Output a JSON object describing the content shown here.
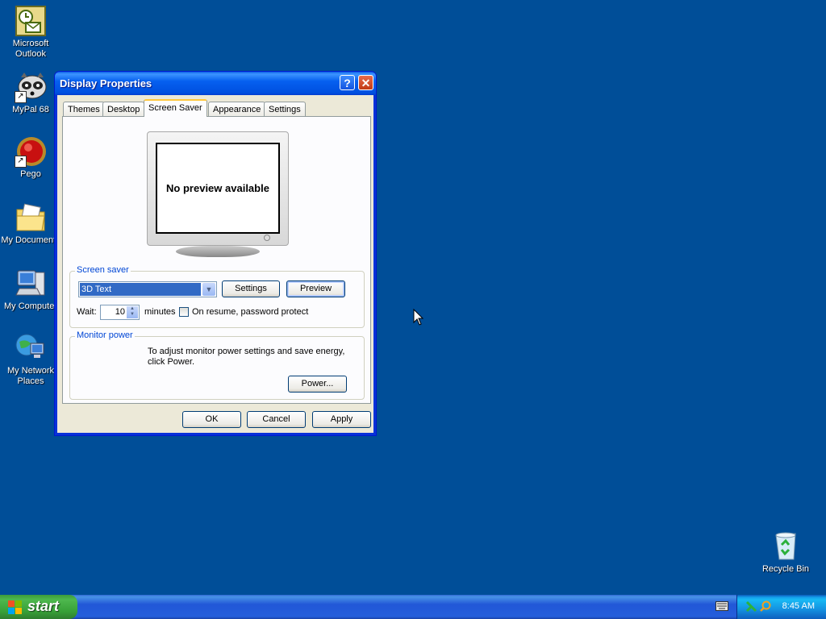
{
  "desktop": {
    "icons": [
      {
        "label": "Microsoft Outlook",
        "icon": "outlook-icon"
      },
      {
        "label": "MyPal 68",
        "icon": "raccoon-icon"
      },
      {
        "label": "Pego",
        "icon": "red-ball-icon"
      },
      {
        "label": "My Documents",
        "icon": "folder-icon"
      },
      {
        "label": "My Computer",
        "icon": "computer-icon"
      },
      {
        "label": "My Network Places",
        "icon": "network-icon"
      },
      {
        "label": "Recycle Bin",
        "icon": "recycle-bin-icon"
      }
    ]
  },
  "window": {
    "title": "Display Properties",
    "help_button": "?",
    "close_button": "✕",
    "tabs": [
      {
        "label": "Themes",
        "active": false
      },
      {
        "label": "Desktop",
        "active": false
      },
      {
        "label": "Screen Saver",
        "active": true
      },
      {
        "label": "Appearance",
        "active": false
      },
      {
        "label": "Settings",
        "active": false
      }
    ],
    "preview_text": "No preview available",
    "screen_saver_group": {
      "label": "Screen saver",
      "selected": "3D Text",
      "settings_button": "Settings",
      "preview_button": "Preview",
      "wait_label": "Wait:",
      "wait_value": "10",
      "minutes_label": "minutes",
      "password_label": "On resume, password protect",
      "password_checked": false
    },
    "monitor_power_group": {
      "label": "Monitor power",
      "description_line1": "To adjust monitor power settings and save energy,",
      "description_line2": "click Power.",
      "power_button": "Power..."
    },
    "buttons": {
      "ok": "OK",
      "cancel": "Cancel",
      "apply": "Apply"
    }
  },
  "taskbar": {
    "start_label": "start",
    "clock": "8:45 AM"
  },
  "colors": {
    "desktop": "#004e98",
    "titlebar": "#0054e3",
    "accent_tab": "#ffc83c",
    "group_label": "#0046d5"
  }
}
